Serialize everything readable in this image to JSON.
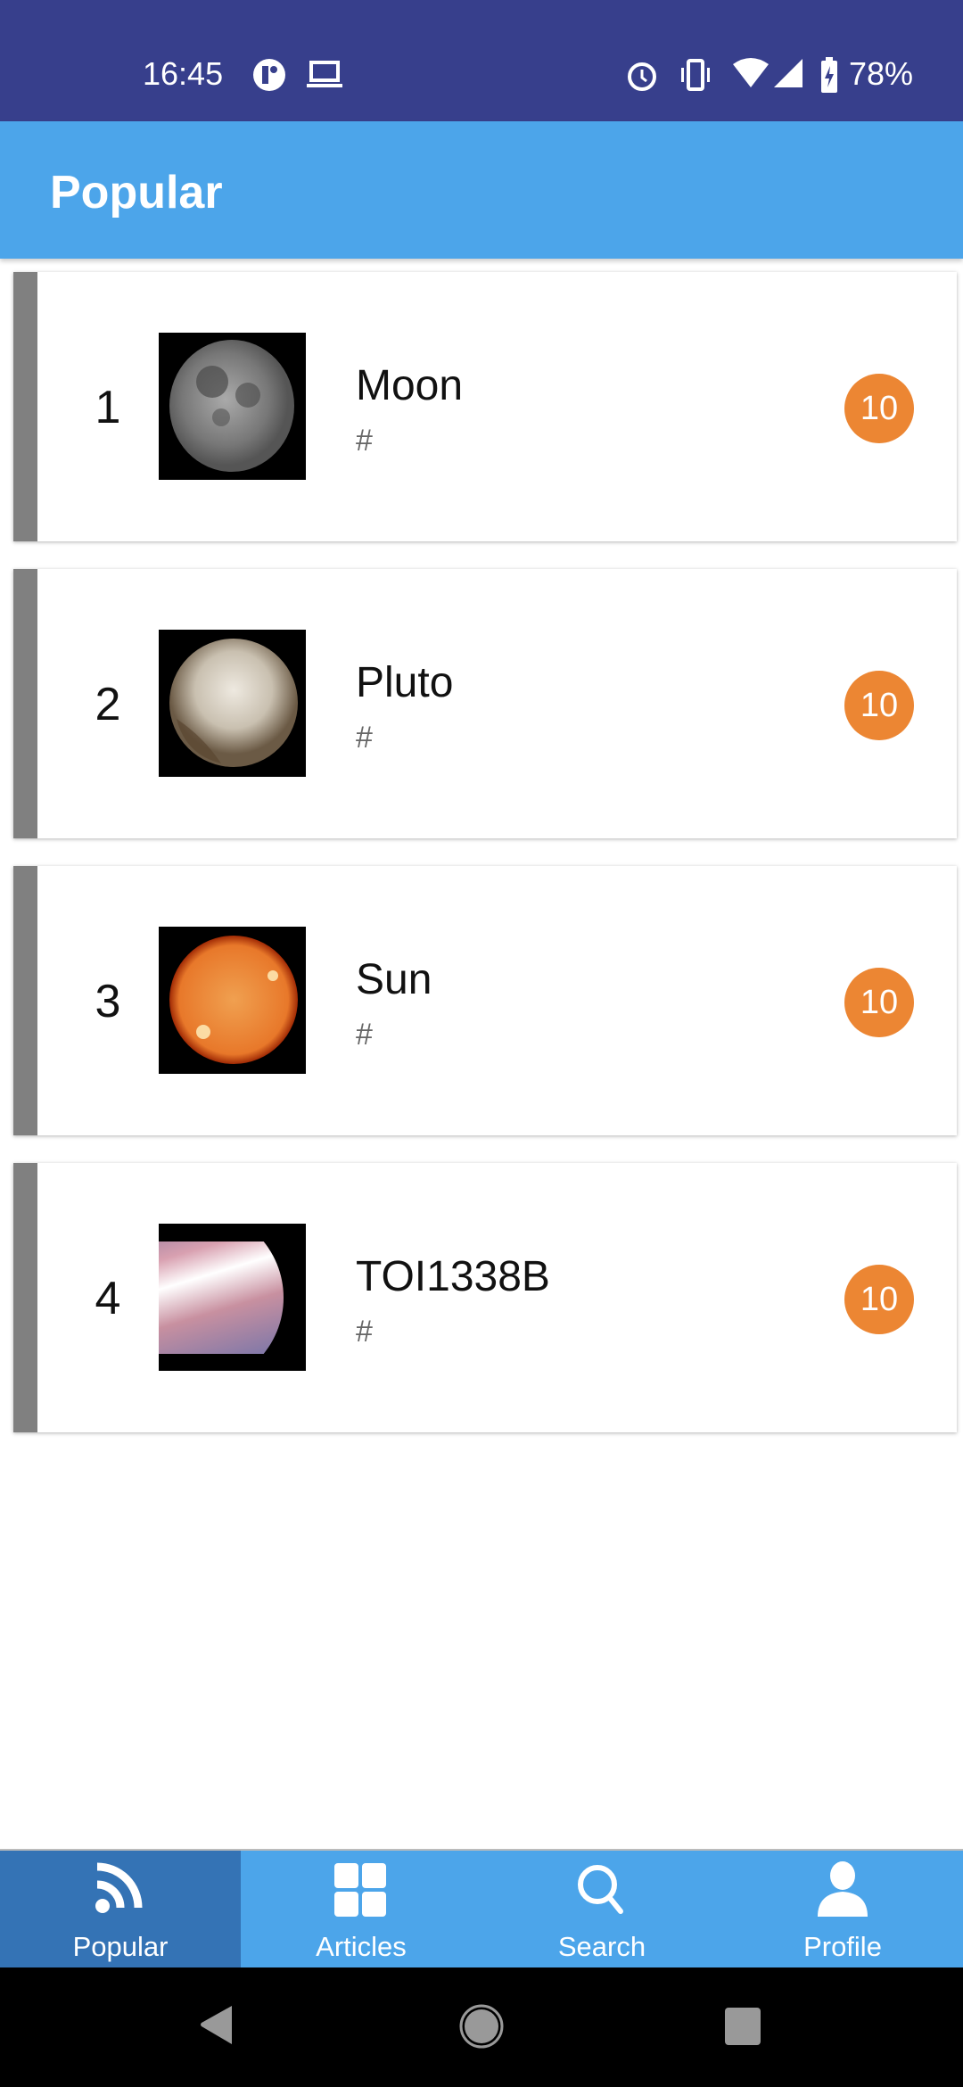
{
  "status_bar": {
    "time": "16:45",
    "battery": "78%",
    "icons": [
      "app-icon",
      "laptop-icon",
      "alarm-icon",
      "vibrate-icon",
      "wifi-icon",
      "signal-icon",
      "battery-charging-icon"
    ]
  },
  "app_bar": {
    "title": "Popular"
  },
  "items": [
    {
      "rank": "1",
      "title": "Moon",
      "subtitle": "#",
      "count": "10",
      "image": "moon"
    },
    {
      "rank": "2",
      "title": "Pluto",
      "subtitle": "#",
      "count": "10",
      "image": "pluto"
    },
    {
      "rank": "3",
      "title": "Sun",
      "subtitle": "#",
      "count": "10",
      "image": "sun"
    },
    {
      "rank": "4",
      "title": "TOI1338B",
      "subtitle": "#",
      "count": "10",
      "image": "exoplanet"
    }
  ],
  "bottom_nav": {
    "tabs": [
      {
        "label": "Popular",
        "icon": "rss-icon",
        "active": true
      },
      {
        "label": "Articles",
        "icon": "grid-icon",
        "active": false
      },
      {
        "label": "Search",
        "icon": "search-icon",
        "active": false
      },
      {
        "label": "Profile",
        "icon": "person-icon",
        "active": false
      }
    ]
  },
  "colors": {
    "status_bar": "#373F8C",
    "app_bar": "#4CA5EA",
    "active_tab": "#3473B5",
    "badge": "#EC8633",
    "strip": "#808080"
  }
}
